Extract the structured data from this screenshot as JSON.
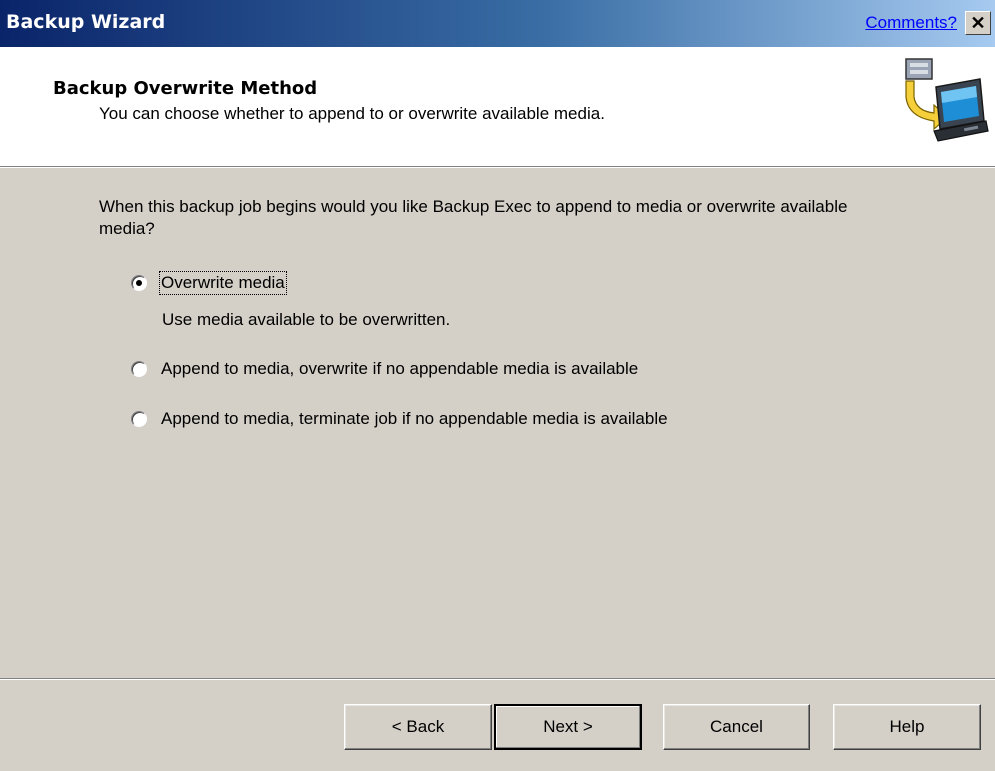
{
  "window": {
    "title": "Backup Wizard",
    "comments_link": "Comments?",
    "close_glyph": "✕"
  },
  "header": {
    "title": "Backup Overwrite Method",
    "subtitle": "You can choose whether to append to or overwrite available media.",
    "icon": "backup-computer-icon"
  },
  "body": {
    "question": "When this backup job begins would you like Backup Exec to append to media or overwrite available media?",
    "options": [
      {
        "label": "Overwrite media",
        "selected": true
      },
      {
        "label": "Append to media, overwrite if no appendable media is available",
        "selected": false
      },
      {
        "label": "Append to media, terminate job if no appendable media is available",
        "selected": false
      }
    ],
    "overwrite_hint": "Use media available to be overwritten."
  },
  "buttons": {
    "back": "< Back",
    "next": "Next >",
    "cancel": "Cancel",
    "help": "Help"
  },
  "colors": {
    "titlebar_start": "#0a246a",
    "titlebar_end": "#a6caf0",
    "dialog_bg": "#d4d0c8"
  }
}
